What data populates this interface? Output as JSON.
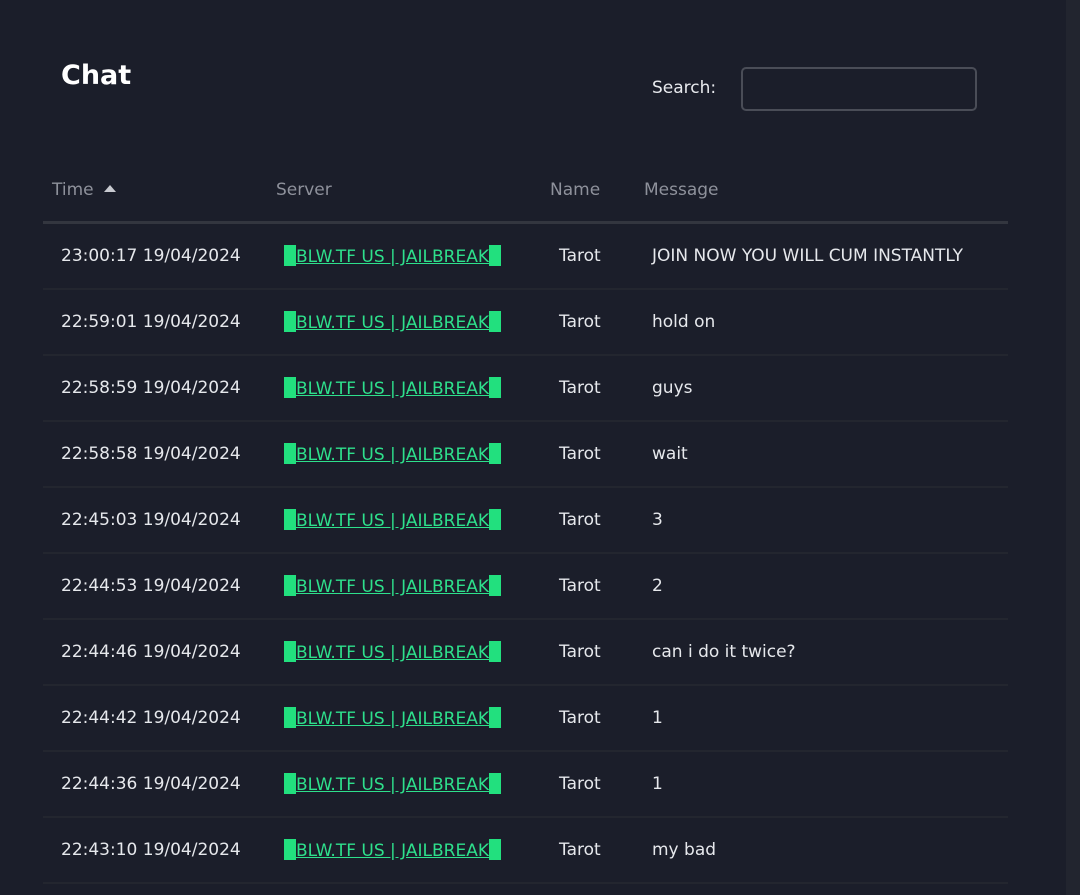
{
  "page": {
    "title": "Chat"
  },
  "search": {
    "label": "Search:",
    "value": "",
    "placeholder": ""
  },
  "table": {
    "headers": {
      "time": "Time",
      "server": "Server",
      "name": "Name",
      "message": "Message"
    },
    "sort": {
      "column": "time",
      "direction": "ascending-indicator"
    },
    "server_block_color": "#22e07e",
    "rows": [
      {
        "time": "23:00:17 19/04/2024",
        "server": "BLW.TF US | JAILBREAK",
        "name": "Tarot",
        "message": "JOIN NOW YOU WILL CUM INSTANTLY"
      },
      {
        "time": "22:59:01 19/04/2024",
        "server": "BLW.TF US | JAILBREAK",
        "name": "Tarot",
        "message": "hold on"
      },
      {
        "time": "22:58:59 19/04/2024",
        "server": "BLW.TF US | JAILBREAK",
        "name": "Tarot",
        "message": "guys"
      },
      {
        "time": "22:58:58 19/04/2024",
        "server": "BLW.TF US | JAILBREAK",
        "name": "Tarot",
        "message": "wait"
      },
      {
        "time": "22:45:03 19/04/2024",
        "server": "BLW.TF US | JAILBREAK",
        "name": "Tarot",
        "message": "3"
      },
      {
        "time": "22:44:53 19/04/2024",
        "server": "BLW.TF US | JAILBREAK",
        "name": "Tarot",
        "message": "2"
      },
      {
        "time": "22:44:46 19/04/2024",
        "server": "BLW.TF US | JAILBREAK",
        "name": "Tarot",
        "message": "can i do it twice?"
      },
      {
        "time": "22:44:42 19/04/2024",
        "server": "BLW.TF US | JAILBREAK",
        "name": "Tarot",
        "message": "1"
      },
      {
        "time": "22:44:36 19/04/2024",
        "server": "BLW.TF US | JAILBREAK",
        "name": "Tarot",
        "message": "1"
      },
      {
        "time": "22:43:10 19/04/2024",
        "server": "BLW.TF US | JAILBREAK",
        "name": "Tarot",
        "message": "my bad"
      }
    ]
  }
}
